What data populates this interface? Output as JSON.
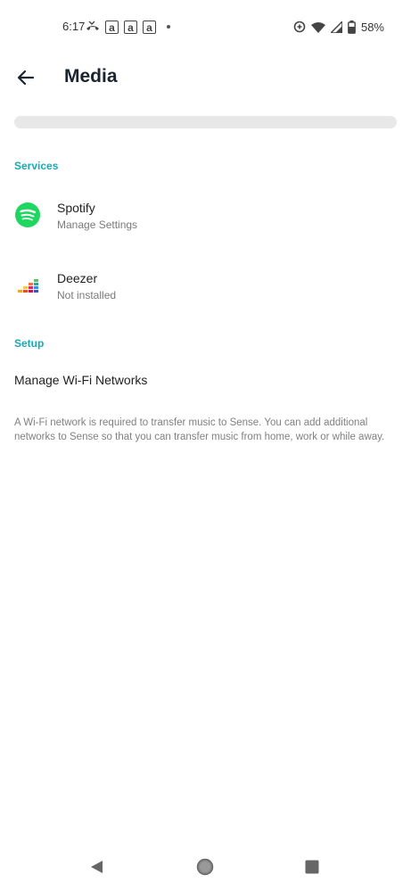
{
  "status_bar": {
    "time": "6:17",
    "notification_letters": [
      "a",
      "a",
      "a"
    ],
    "battery": "58%"
  },
  "app_bar": {
    "title": "Media"
  },
  "services": {
    "header": "Services",
    "items": [
      {
        "title": "Spotify",
        "subtitle": "Manage Settings",
        "icon": "spotify-icon"
      },
      {
        "title": "Deezer",
        "subtitle": "Not installed",
        "icon": "deezer-icon"
      }
    ]
  },
  "setup": {
    "header": "Setup",
    "wifi_label": "Manage Wi-Fi Networks",
    "note": "A Wi-Fi network is required to transfer music to Sense. You can add additional networks to Sense so that you can transfer music from home, work or while away."
  },
  "colors": {
    "accent": "#1aa9b5",
    "spotify": "#1ed760"
  }
}
